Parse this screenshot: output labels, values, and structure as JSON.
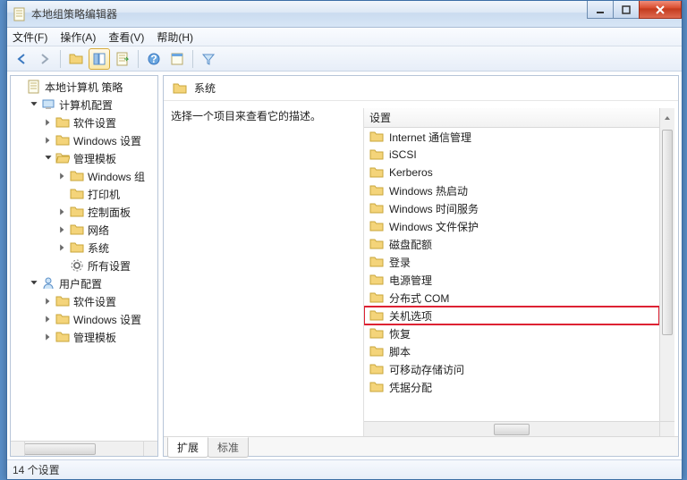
{
  "window": {
    "title": "本地组策略编辑器"
  },
  "menus": {
    "file": "文件(F)",
    "action": "操作(A)",
    "view": "查看(V)",
    "help": "帮助(H)"
  },
  "tree": {
    "root": "本地计算机 策略",
    "computer_config": "计算机配置",
    "software_settings": "软件设置",
    "windows_settings": "Windows 设置",
    "admin_templates": "管理模板",
    "windows_components": "Windows 组",
    "printers": "打印机",
    "control_panel": "控制面板",
    "network": "网络",
    "system": "系统",
    "all_settings": "所有设置",
    "user_config": "用户配置",
    "u_software_settings": "软件设置",
    "u_windows_settings": "Windows 设置",
    "u_admin_templates": "管理模板"
  },
  "header": {
    "title": "系统"
  },
  "description": "选择一个项目来查看它的描述。",
  "list_header": "设置",
  "items": [
    "Internet 通信管理",
    "iSCSI",
    "Kerberos",
    "Windows 热启动",
    "Windows 时间服务",
    "Windows 文件保护",
    "磁盘配额",
    "登录",
    "电源管理",
    "分布式 COM",
    "关机选项",
    "恢复",
    "脚本",
    "可移动存储访问",
    "凭据分配"
  ],
  "highlight_index": 10,
  "tabs": {
    "extended": "扩展",
    "standard": "标准"
  },
  "status": "14 个设置"
}
